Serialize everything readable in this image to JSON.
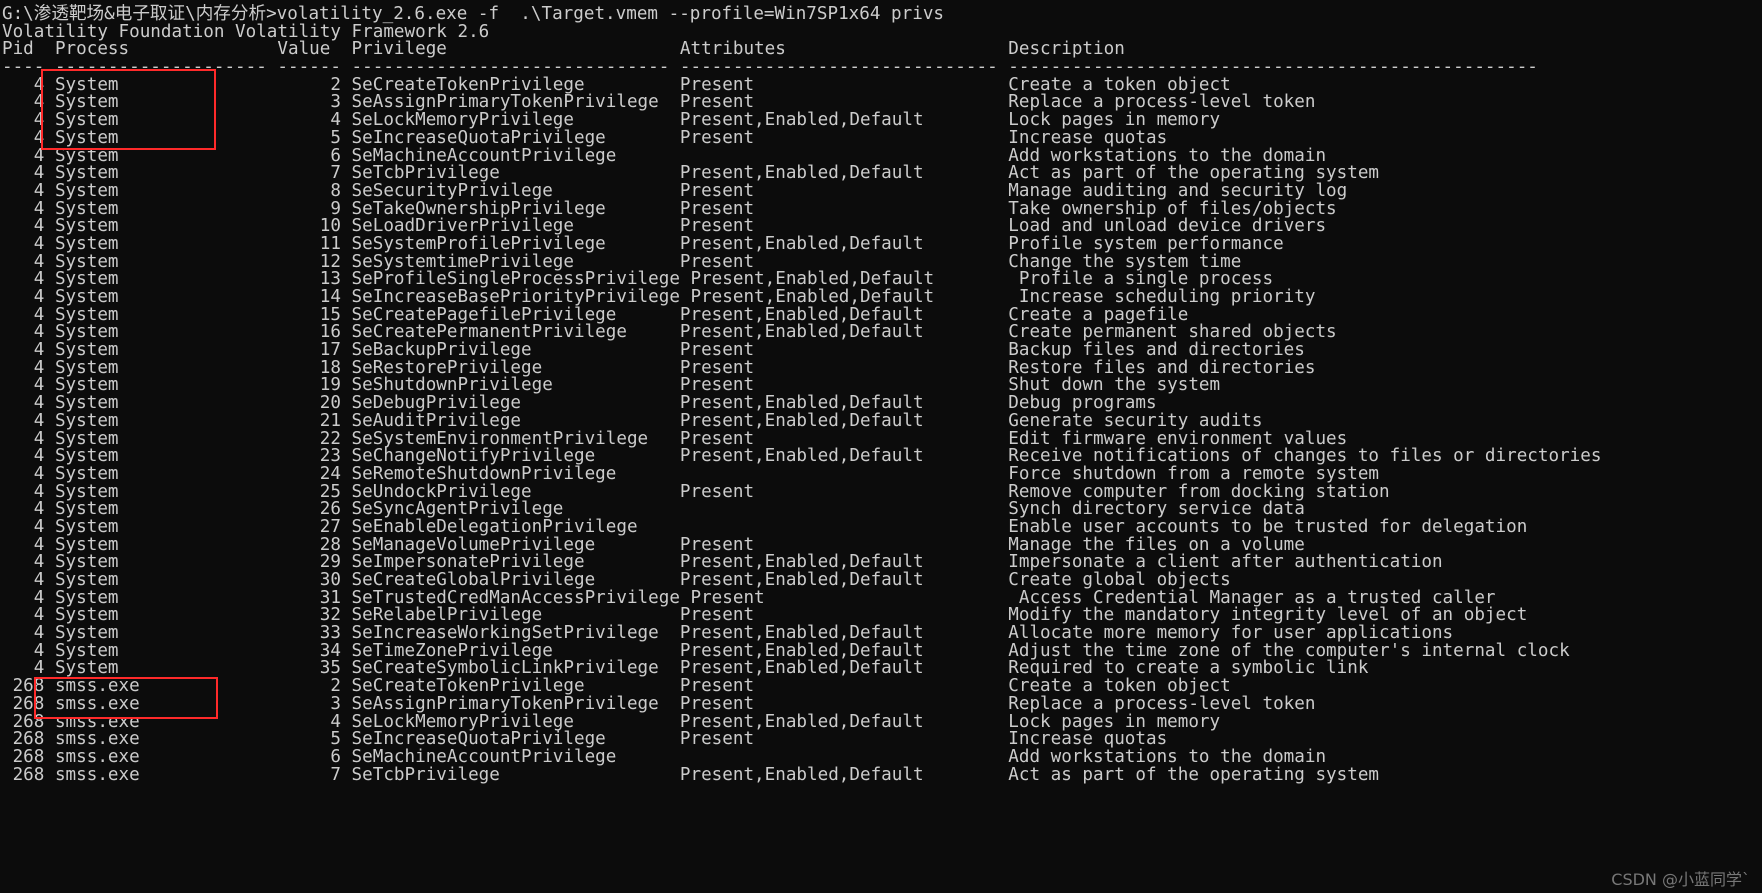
{
  "terminal": {
    "prompt_line": "G:\\渗透靶场&电子取证\\内存分析>volatility_2.6.exe -f  .\\Target.vmem --profile=Win7SP1x64 privs",
    "banner": "Volatility Foundation Volatility Framework 2.6",
    "columns": {
      "pid": "Pid",
      "process": "Process",
      "value": "Value",
      "privilege": "Privilege",
      "attributes": "Attributes",
      "description": "Description"
    },
    "separator": "---- -------------------- ------ ------------------------------ ------------------------------ --------------------------------------------------",
    "colors": {
      "background": "#0c0c0c",
      "foreground": "#cccccc",
      "annotation": "#ff2a2a",
      "watermark": "#8a8a8a"
    },
    "rows": [
      {
        "pid": "4",
        "process": "System",
        "value": "2",
        "privilege": "SeCreateTokenPrivilege",
        "attributes": "Present",
        "description": "Create a token object"
      },
      {
        "pid": "4",
        "process": "System",
        "value": "3",
        "privilege": "SeAssignPrimaryTokenPrivilege",
        "attributes": "Present",
        "description": "Replace a process-level token"
      },
      {
        "pid": "4",
        "process": "System",
        "value": "4",
        "privilege": "SeLockMemoryPrivilege",
        "attributes": "Present,Enabled,Default",
        "description": "Lock pages in memory"
      },
      {
        "pid": "4",
        "process": "System",
        "value": "5",
        "privilege": "SeIncreaseQuotaPrivilege",
        "attributes": "Present",
        "description": "Increase quotas"
      },
      {
        "pid": "4",
        "process": "System",
        "value": "6",
        "privilege": "SeMachineAccountPrivilege",
        "attributes": "",
        "description": "Add workstations to the domain"
      },
      {
        "pid": "4",
        "process": "System",
        "value": "7",
        "privilege": "SeTcbPrivilege",
        "attributes": "Present,Enabled,Default",
        "description": "Act as part of the operating system"
      },
      {
        "pid": "4",
        "process": "System",
        "value": "8",
        "privilege": "SeSecurityPrivilege",
        "attributes": "Present",
        "description": "Manage auditing and security log"
      },
      {
        "pid": "4",
        "process": "System",
        "value": "9",
        "privilege": "SeTakeOwnershipPrivilege",
        "attributes": "Present",
        "description": "Take ownership of files/objects"
      },
      {
        "pid": "4",
        "process": "System",
        "value": "10",
        "privilege": "SeLoadDriverPrivilege",
        "attributes": "Present",
        "description": "Load and unload device drivers"
      },
      {
        "pid": "4",
        "process": "System",
        "value": "11",
        "privilege": "SeSystemProfilePrivilege",
        "attributes": "Present,Enabled,Default",
        "description": "Profile system performance"
      },
      {
        "pid": "4",
        "process": "System",
        "value": "12",
        "privilege": "SeSystemtimePrivilege",
        "attributes": "Present",
        "description": "Change the system time"
      },
      {
        "pid": "4",
        "process": "System",
        "value": "13",
        "privilege": "SeProfileSingleProcessPrivilege",
        "attributes": "Present,Enabled,Default",
        "description": "Profile a single process"
      },
      {
        "pid": "4",
        "process": "System",
        "value": "14",
        "privilege": "SeIncreaseBasePriorityPrivilege",
        "attributes": "Present,Enabled,Default",
        "description": "Increase scheduling priority"
      },
      {
        "pid": "4",
        "process": "System",
        "value": "15",
        "privilege": "SeCreatePagefilePrivilege",
        "attributes": "Present,Enabled,Default",
        "description": "Create a pagefile"
      },
      {
        "pid": "4",
        "process": "System",
        "value": "16",
        "privilege": "SeCreatePermanentPrivilege",
        "attributes": "Present,Enabled,Default",
        "description": "Create permanent shared objects"
      },
      {
        "pid": "4",
        "process": "System",
        "value": "17",
        "privilege": "SeBackupPrivilege",
        "attributes": "Present",
        "description": "Backup files and directories"
      },
      {
        "pid": "4",
        "process": "System",
        "value": "18",
        "privilege": "SeRestorePrivilege",
        "attributes": "Present",
        "description": "Restore files and directories"
      },
      {
        "pid": "4",
        "process": "System",
        "value": "19",
        "privilege": "SeShutdownPrivilege",
        "attributes": "Present",
        "description": "Shut down the system"
      },
      {
        "pid": "4",
        "process": "System",
        "value": "20",
        "privilege": "SeDebugPrivilege",
        "attributes": "Present,Enabled,Default",
        "description": "Debug programs"
      },
      {
        "pid": "4",
        "process": "System",
        "value": "21",
        "privilege": "SeAuditPrivilege",
        "attributes": "Present,Enabled,Default",
        "description": "Generate security audits"
      },
      {
        "pid": "4",
        "process": "System",
        "value": "22",
        "privilege": "SeSystemEnvironmentPrivilege",
        "attributes": "Present",
        "description": "Edit firmware environment values"
      },
      {
        "pid": "4",
        "process": "System",
        "value": "23",
        "privilege": "SeChangeNotifyPrivilege",
        "attributes": "Present,Enabled,Default",
        "description": "Receive notifications of changes to files or directories"
      },
      {
        "pid": "4",
        "process": "System",
        "value": "24",
        "privilege": "SeRemoteShutdownPrivilege",
        "attributes": "",
        "description": "Force shutdown from a remote system"
      },
      {
        "pid": "4",
        "process": "System",
        "value": "25",
        "privilege": "SeUndockPrivilege",
        "attributes": "Present",
        "description": "Remove computer from docking station"
      },
      {
        "pid": "4",
        "process": "System",
        "value": "26",
        "privilege": "SeSyncAgentPrivilege",
        "attributes": "",
        "description": "Synch directory service data"
      },
      {
        "pid": "4",
        "process": "System",
        "value": "27",
        "privilege": "SeEnableDelegationPrivilege",
        "attributes": "",
        "description": "Enable user accounts to be trusted for delegation"
      },
      {
        "pid": "4",
        "process": "System",
        "value": "28",
        "privilege": "SeManageVolumePrivilege",
        "attributes": "Present",
        "description": "Manage the files on a volume"
      },
      {
        "pid": "4",
        "process": "System",
        "value": "29",
        "privilege": "SeImpersonatePrivilege",
        "attributes": "Present,Enabled,Default",
        "description": "Impersonate a client after authentication"
      },
      {
        "pid": "4",
        "process": "System",
        "value": "30",
        "privilege": "SeCreateGlobalPrivilege",
        "attributes": "Present,Enabled,Default",
        "description": "Create global objects"
      },
      {
        "pid": "4",
        "process": "System",
        "value": "31",
        "privilege": "SeTrustedCredManAccessPrivilege",
        "attributes": "Present",
        "description": "Access Credential Manager as a trusted caller"
      },
      {
        "pid": "4",
        "process": "System",
        "value": "32",
        "privilege": "SeRelabelPrivilege",
        "attributes": "Present",
        "description": "Modify the mandatory integrity level of an object"
      },
      {
        "pid": "4",
        "process": "System",
        "value": "33",
        "privilege": "SeIncreaseWorkingSetPrivilege",
        "attributes": "Present,Enabled,Default",
        "description": "Allocate more memory for user applications"
      },
      {
        "pid": "4",
        "process": "System",
        "value": "34",
        "privilege": "SeTimeZonePrivilege",
        "attributes": "Present,Enabled,Default",
        "description": "Adjust the time zone of the computer's internal clock"
      },
      {
        "pid": "4",
        "process": "System",
        "value": "35",
        "privilege": "SeCreateSymbolicLinkPrivilege",
        "attributes": "Present,Enabled,Default",
        "description": "Required to create a symbolic link"
      },
      {
        "pid": "268",
        "process": "smss.exe",
        "value": "2",
        "privilege": "SeCreateTokenPrivilege",
        "attributes": "Present",
        "description": "Create a token object"
      },
      {
        "pid": "268",
        "process": "smss.exe",
        "value": "3",
        "privilege": "SeAssignPrimaryTokenPrivilege",
        "attributes": "Present",
        "description": "Replace a process-level token"
      },
      {
        "pid": "268",
        "process": "smss.exe",
        "value": "4",
        "privilege": "SeLockMemoryPrivilege",
        "attributes": "Present,Enabled,Default",
        "description": "Lock pages in memory"
      },
      {
        "pid": "268",
        "process": "smss.exe",
        "value": "5",
        "privilege": "SeIncreaseQuotaPrivilege",
        "attributes": "Present",
        "description": "Increase quotas"
      },
      {
        "pid": "268",
        "process": "smss.exe",
        "value": "6",
        "privilege": "SeMachineAccountPrivilege",
        "attributes": "",
        "description": "Add workstations to the domain"
      },
      {
        "pid": "268",
        "process": "smss.exe",
        "value": "7",
        "privilege": "SeTcbPrivilege",
        "attributes": "Present,Enabled,Default",
        "description": "Act as part of the operating system"
      }
    ]
  },
  "annotations": [
    {
      "name": "highlight-system-rows",
      "label": ""
    },
    {
      "name": "highlight-smss-rows",
      "label": ""
    }
  ],
  "watermark": {
    "text": "CSDN @小蓝同学`"
  }
}
